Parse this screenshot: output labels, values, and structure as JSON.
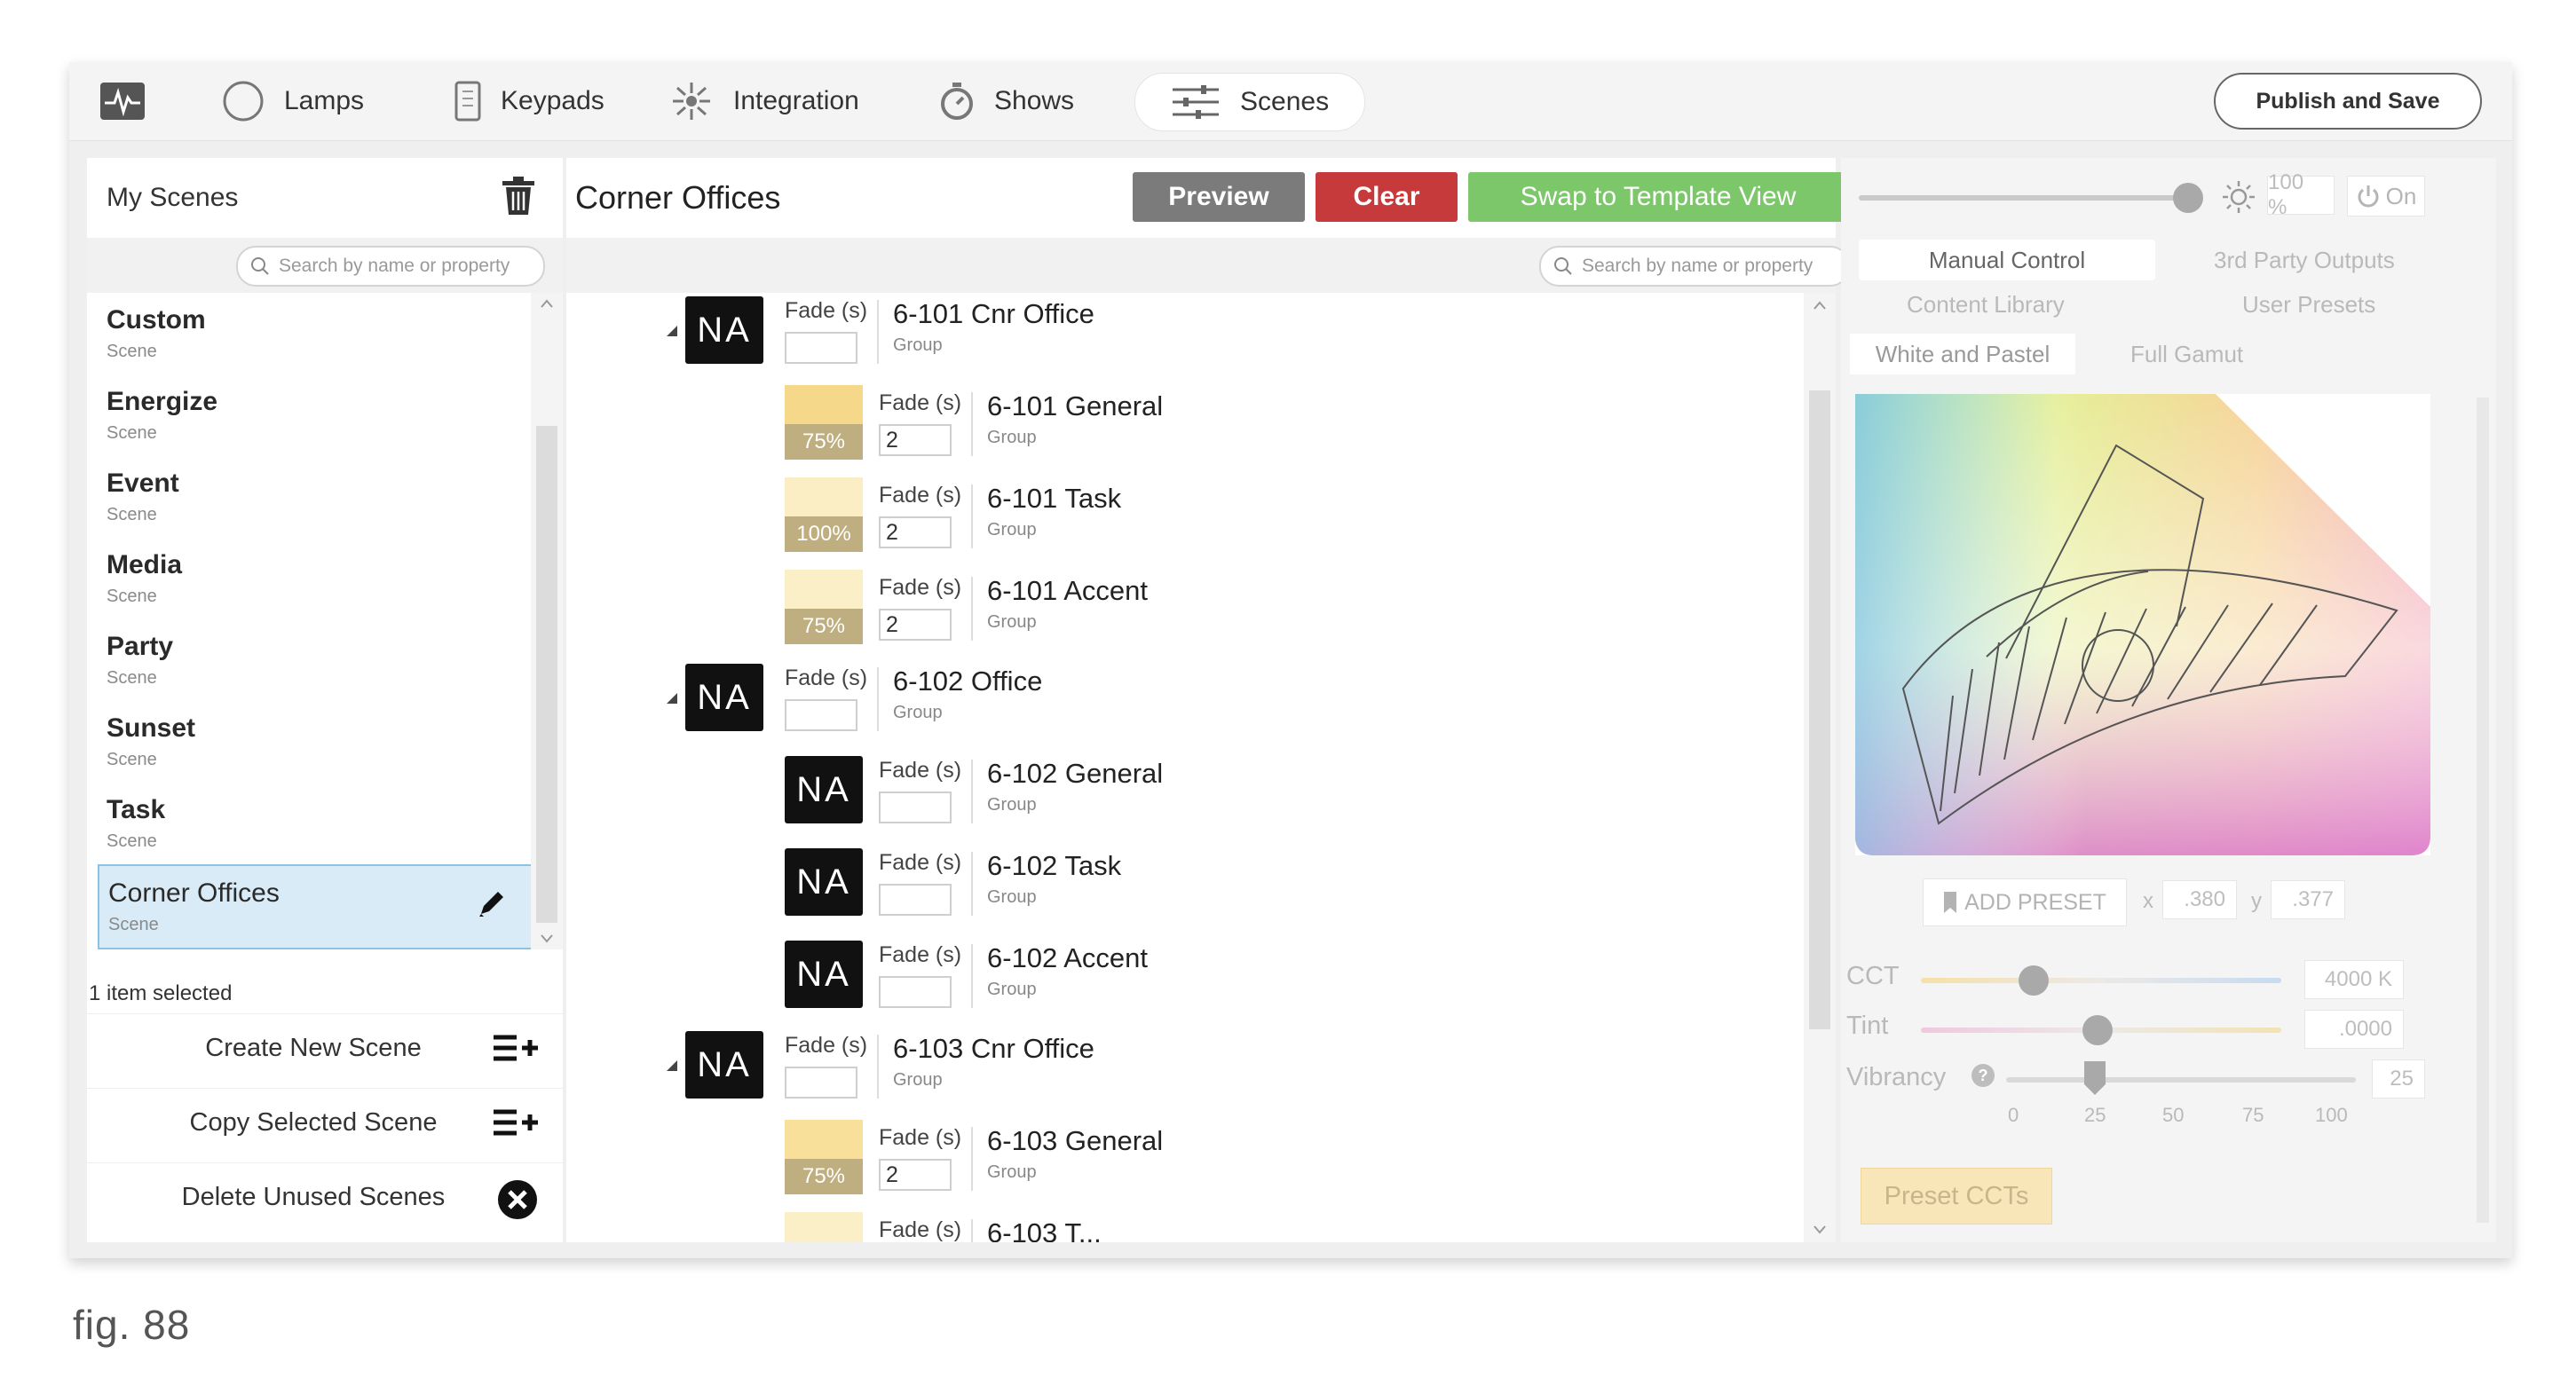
{
  "nav": {
    "items": [
      {
        "label": "",
        "icon": "activity-icon"
      },
      {
        "label": "Lamps",
        "icon": "lamp-icon"
      },
      {
        "label": "Keypads",
        "icon": "keypad-icon"
      },
      {
        "label": "Integration",
        "icon": "integration-icon"
      },
      {
        "label": "Shows",
        "icon": "stopwatch-icon"
      },
      {
        "label": "Scenes",
        "icon": "sliders-icon",
        "active": true
      }
    ],
    "publish_label": "Publish and Save"
  },
  "left_panel": {
    "title": "My Scenes",
    "search_placeholder": "Search by name or property",
    "scenes": [
      {
        "name": "Custom",
        "type": "Scene"
      },
      {
        "name": "Energize",
        "type": "Scene"
      },
      {
        "name": "Event",
        "type": "Scene"
      },
      {
        "name": "Media",
        "type": "Scene"
      },
      {
        "name": "Party",
        "type": "Scene"
      },
      {
        "name": "Sunset",
        "type": "Scene"
      },
      {
        "name": "Task",
        "type": "Scene"
      },
      {
        "name": "Corner Offices",
        "type": "Scene",
        "selected": true
      }
    ],
    "selection_info": "1 item selected",
    "actions": [
      {
        "label": "Create New Scene",
        "icon": "add-list-icon"
      },
      {
        "label": "Copy Selected Scene",
        "icon": "add-list-icon"
      },
      {
        "label": "Delete Unused Scenes",
        "icon": "close-circle-icon"
      }
    ]
  },
  "middle": {
    "title": "Corner Offices",
    "buttons": {
      "preview": "Preview",
      "clear": "Clear",
      "swap": "Swap to Template View"
    },
    "search_placeholder": "Search by name or property",
    "fade_label": "Fade (s)",
    "rows": [
      {
        "name": "6-101 Cnr Office",
        "type": "Group",
        "badge": "NA",
        "fade": "",
        "parent": true
      },
      {
        "name": "6-101 General",
        "type": "Group",
        "level": "75%",
        "fade": "2"
      },
      {
        "name": "6-101 Task",
        "type": "Group",
        "level": "100%",
        "fade": "2"
      },
      {
        "name": "6-101 Accent",
        "type": "Group",
        "level": "75%",
        "fade": "2"
      },
      {
        "name": "6-102 Office",
        "type": "Group",
        "badge": "NA",
        "fade": "",
        "parent": true
      },
      {
        "name": "6-102 General",
        "type": "Group",
        "badge": "NA",
        "fade": ""
      },
      {
        "name": "6-102 Task",
        "type": "Group",
        "badge": "NA",
        "fade": ""
      },
      {
        "name": "6-102 Accent",
        "type": "Group",
        "badge": "NA",
        "fade": ""
      },
      {
        "name": "6-103 Cnr Office",
        "type": "Group",
        "badge": "NA",
        "fade": "",
        "parent": true
      },
      {
        "name": "6-103 General",
        "type": "Group",
        "level": "75%",
        "fade": "2"
      },
      {
        "name": "6-103 T...",
        "type": "Group",
        "level": "",
        "fade": ""
      }
    ]
  },
  "right_panel": {
    "brightness": "100 %",
    "power": "On",
    "tabs_row1": [
      "Manual Control",
      "3rd Party Outputs"
    ],
    "tabs_row2": [
      "Content Library",
      "User Presets"
    ],
    "tabs_row3": [
      "White and Pastel",
      "Full Gamut"
    ],
    "add_preset": "ADD PRESET",
    "x_label": "x",
    "x_value": ".380",
    "y_label": "y",
    "y_value": ".377",
    "cct_label": "CCT",
    "cct_value": "4000 K",
    "tint_label": "Tint",
    "tint_value": ".0000",
    "vibrancy_label": "Vibrancy",
    "vibrancy_value": "25",
    "vibrancy_ticks": [
      "0",
      "25",
      "50",
      "75",
      "100"
    ],
    "preset_ccts": "Preset CCTs"
  },
  "caption": "fig. 88",
  "colors": {
    "preview": "#7b7b7b",
    "clear": "#c73a3c",
    "swap": "#7dc76b",
    "selected_row": "#d8ebf6"
  }
}
